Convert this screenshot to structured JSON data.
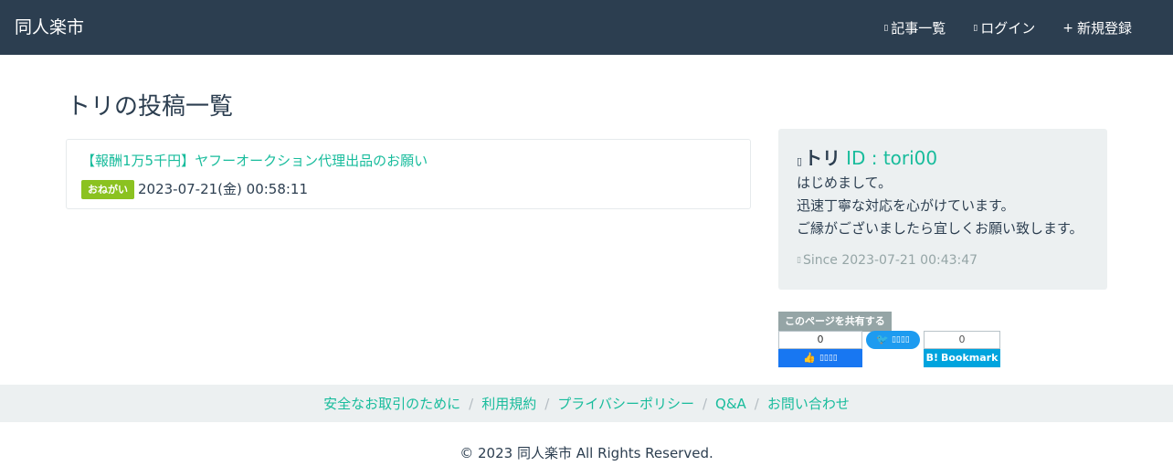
{
  "navbar": {
    "brand": "同人楽市",
    "items": [
      {
        "icon": "article-list-icon",
        "label": "記事一覧"
      },
      {
        "icon": "login-icon",
        "label": "ログイン"
      },
      {
        "icon": "plus-icon",
        "label": "新規登録"
      }
    ]
  },
  "main": {
    "title": "トリの投稿一覧",
    "posts": [
      {
        "title": "【報酬1万5千円】ヤフーオークション代理出品のお願い",
        "badge": "おねがい",
        "date": "2023-07-21(金) 00:58:11"
      }
    ]
  },
  "profile": {
    "name": "トリ",
    "id": "ID : tori00",
    "bio": [
      "はじめまして。",
      "迅速丁寧な対応を心がけています。",
      "ご縁がございましたら宜しくお願い致します。"
    ],
    "since": "Since 2023-07-21 00:43:47"
  },
  "share": {
    "label": "このページを共有する",
    "facebook_count": "0",
    "hatena_count": "0",
    "hatena_label": "Bookmark"
  },
  "footer": {
    "links": [
      "安全なお取引のために",
      "利用規約",
      "プライバシーポリシー",
      "Q&A",
      "お問い合わせ"
    ],
    "separator": "/",
    "copyright": "© 2023 同人楽市 All Rights Reserved."
  },
  "colors": {
    "navbar": "#2c3e50",
    "link": "#18bc9c",
    "badge": "#8bc220",
    "panel": "#ecf0f1",
    "facebook": "#1877f2",
    "twitter": "#1d9bf0",
    "hatena": "#00a4de"
  }
}
